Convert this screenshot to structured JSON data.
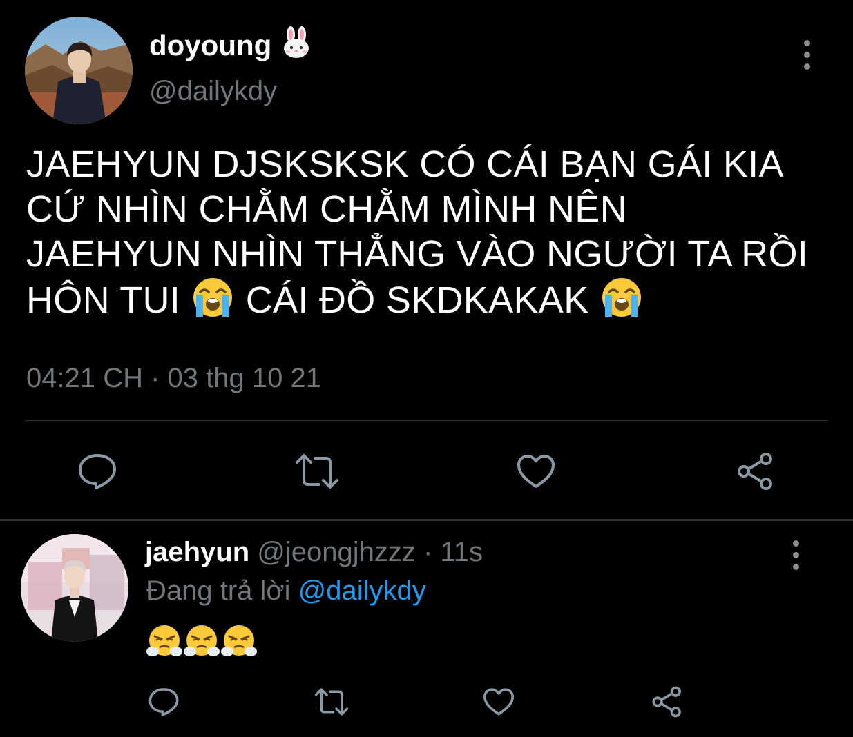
{
  "main_tweet": {
    "display_name": "doyoung",
    "name_emoji": "rabbit-face-emoji",
    "handle": "@dailykdy",
    "text_lines": [
      "JAEHYUN DJSKSKSK CÓ CÁI BẠN GÁI KIA",
      "CỨ NHÌN CHẰM CHẰM MÌNH NÊN",
      "JAEHYUN NHÌN THẲNG VÀO NGƯỜI TA RỒI",
      "HÔN TUI",
      "CÁI ĐỒ SKDKAKAK"
    ],
    "text_emoji": "loudly-crying-face-emoji",
    "timestamp": "04:21 CH · 03 thg 10 21"
  },
  "reply_tweet": {
    "display_name": "jaehyun",
    "handle": "@jeongjhzzz",
    "time_sep": " · ",
    "time": "11s",
    "replying_prefix": "Đang trả lời ",
    "replying_to": "@dailykdy",
    "content_emojis": [
      "face-with-steam-from-nose-emoji",
      "face-with-steam-from-nose-emoji",
      "face-with-steam-from-nose-emoji"
    ]
  },
  "actions": [
    "reply-icon",
    "retweet-icon",
    "like-icon",
    "share-icon"
  ],
  "colors": {
    "background": "#000000",
    "primary_text": "#ffffff",
    "secondary_text": "#71767b",
    "link": "#1d9bf0",
    "divider": "#2f3336",
    "icon": "#8b98a5"
  }
}
